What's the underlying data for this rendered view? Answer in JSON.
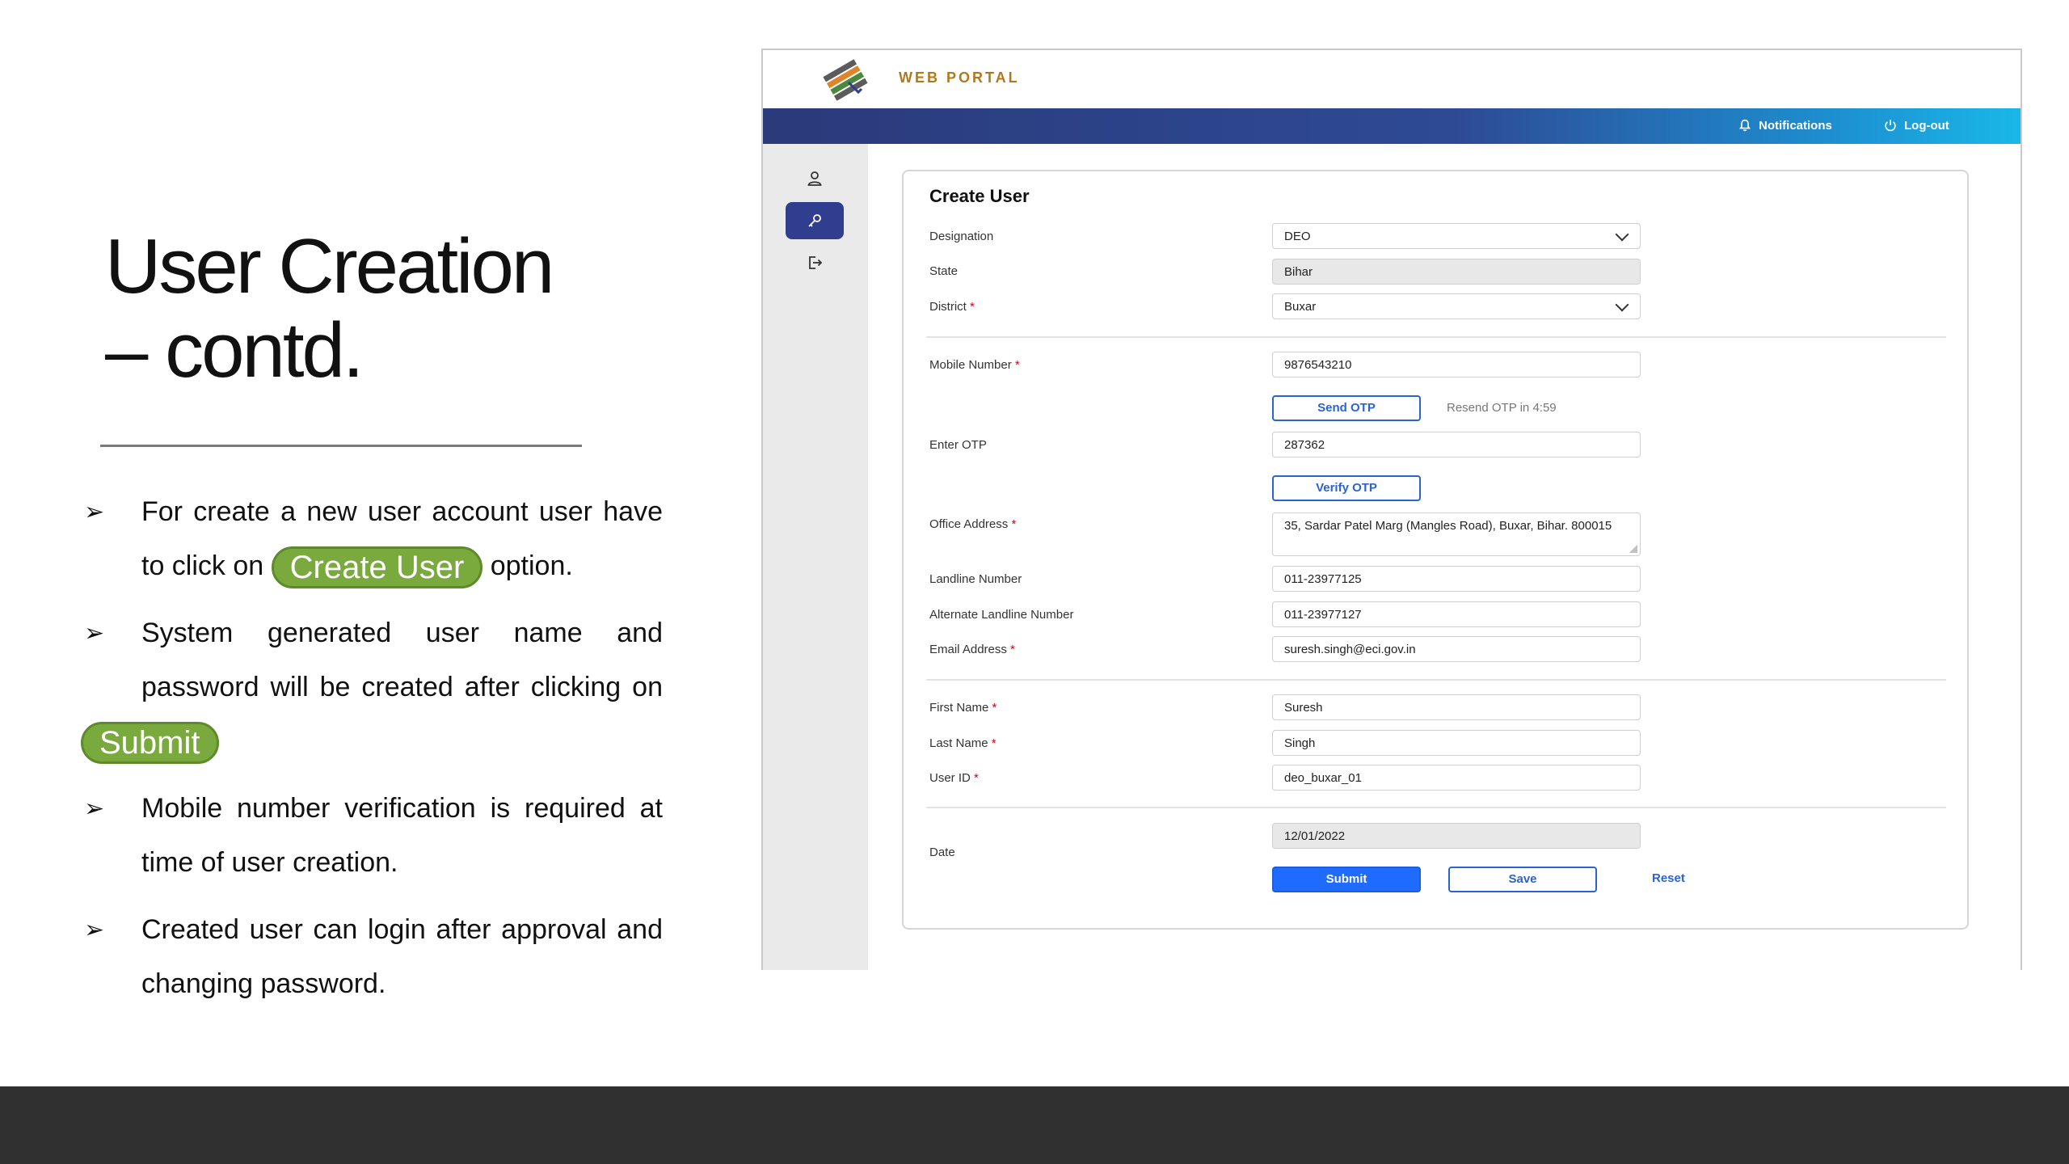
{
  "slide": {
    "title_line1": "User Creation",
    "title_line2": "– contd.",
    "bullets": {
      "b1_text_a": "For create a new user account user have to click on",
      "b1_pill": "Create User",
      "b1_text_b": "option.",
      "b2_text": "System generated user name and password will be created after clicking on",
      "b2_pill": "Submit",
      "b3_text": "Mobile number verification is required at time of user creation.",
      "b4_text": "Created user can login after approval and changing password."
    },
    "arrow_glyph": "➢"
  },
  "portal": {
    "brand": "WEB PORTAL",
    "notifications": "Notifications",
    "logout": "Log-out",
    "icons": [
      "user-icon",
      "key-icon",
      "logout-icon",
      "bell-icon",
      "power-icon"
    ],
    "colors": {
      "accent": "#2f3e8f",
      "primary_button": "#1f6bff",
      "pill_green": "#7aaa3d"
    },
    "form": {
      "title": "Create User",
      "designation_label": "Designation",
      "designation_value": "DEO",
      "state_label": "State",
      "state_value": "Bihar",
      "district_label": "District",
      "district_value": "Buxar",
      "mobile_label": "Mobile Number",
      "mobile_value": "9876543210",
      "send_otp": "Send OTP",
      "resend_text": "Resend OTP in 4:59",
      "otp_label": "Enter OTP",
      "otp_value": "287362",
      "verify_otp": "Verify OTP",
      "office_label": "Office Address",
      "office_value": "35, Sardar Patel Marg (Mangles Road), Buxar, Bihar. 800015",
      "landline_label": "Landline Number",
      "landline_value": "011-23977125",
      "alt_landline_label": "Alternate Landline Number",
      "alt_landline_value": "011-23977127",
      "email_label": "Email Address",
      "email_value": "suresh.singh@eci.gov.in",
      "first_name_label": "First Name",
      "first_name_value": "Suresh",
      "last_name_label": "Last Name",
      "last_name_value": "Singh",
      "user_id_label": "User ID",
      "user_id_value": "deo_buxar_01",
      "date_label": "Date",
      "date_value": "12/01/2022",
      "submit": "Submit",
      "save": "Save",
      "reset": "Reset",
      "required_mark": "*"
    }
  }
}
